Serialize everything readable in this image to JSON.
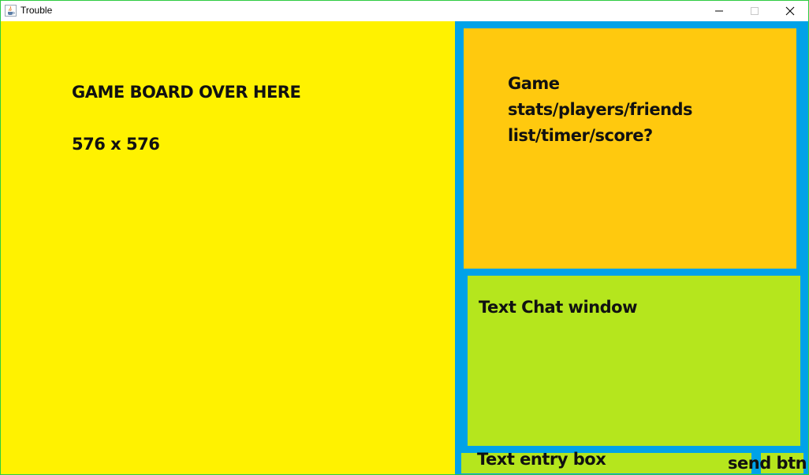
{
  "window": {
    "title": "Trouble",
    "icon": "java-coffee-icon",
    "controls": [
      "minimize-icon",
      "maximize-icon",
      "close-icon"
    ]
  },
  "board": {
    "title": "GAME BOARD OVER HERE",
    "size_label": "576 x 576",
    "color": "#fff200"
  },
  "stats": {
    "lines": [
      "Game",
      "stats/players/friends",
      "list/timer/score?"
    ],
    "color": "#ffc90e"
  },
  "chat": {
    "label": "Text Chat window",
    "color": "#b5e61d"
  },
  "entry": {
    "label": "Text entry box"
  },
  "send": {
    "label": "send btn"
  },
  "colors": {
    "side_panel": "#00a2e8",
    "window_border": "#2ecc40"
  }
}
